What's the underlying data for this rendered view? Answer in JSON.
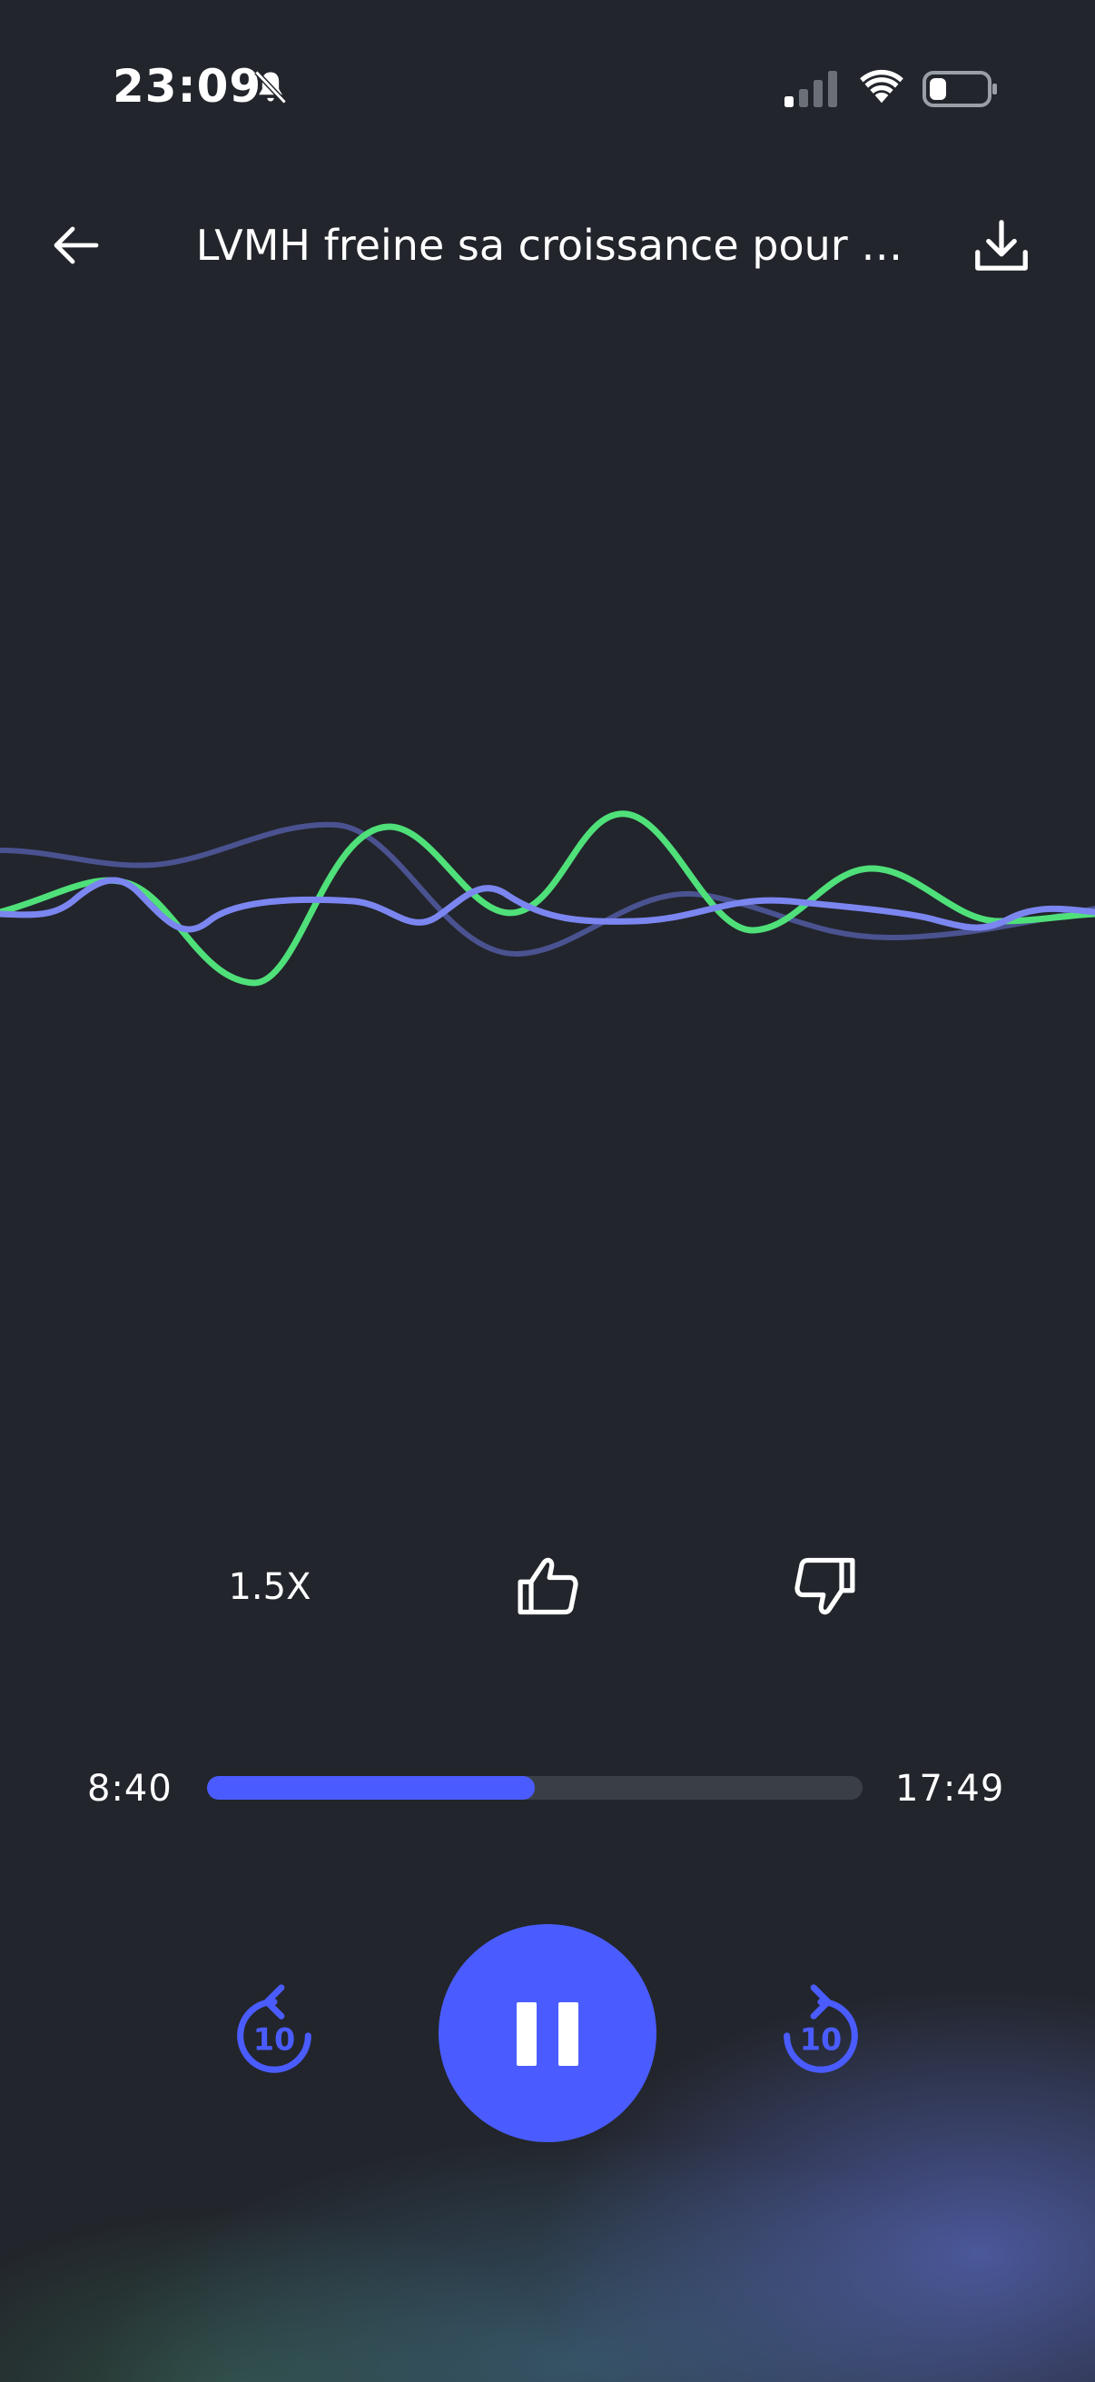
{
  "status_bar": {
    "time": "23:09",
    "icons": [
      "bell-off-icon",
      "signal-icon",
      "wifi-icon",
      "battery-icon"
    ]
  },
  "header": {
    "title": "LVMH freine sa croissance pour …",
    "back_icon": "arrow-left-icon",
    "download_icon": "download-icon"
  },
  "controls": {
    "speed_label": "1.5X",
    "like_icon": "thumbs-up-icon",
    "dislike_icon": "thumbs-down-icon"
  },
  "progress": {
    "current_time": "8:40",
    "total_time": "17:49",
    "fraction": 0.5
  },
  "playback": {
    "rewind_label": "10",
    "forward_label": "10",
    "play_state": "paused-icon"
  },
  "colors": {
    "background": "#22252b",
    "accent": "#4a5cff",
    "wave_green": "#4fe07a",
    "wave_blue": "#7b86f0",
    "wave_dim": "#4a5290"
  }
}
